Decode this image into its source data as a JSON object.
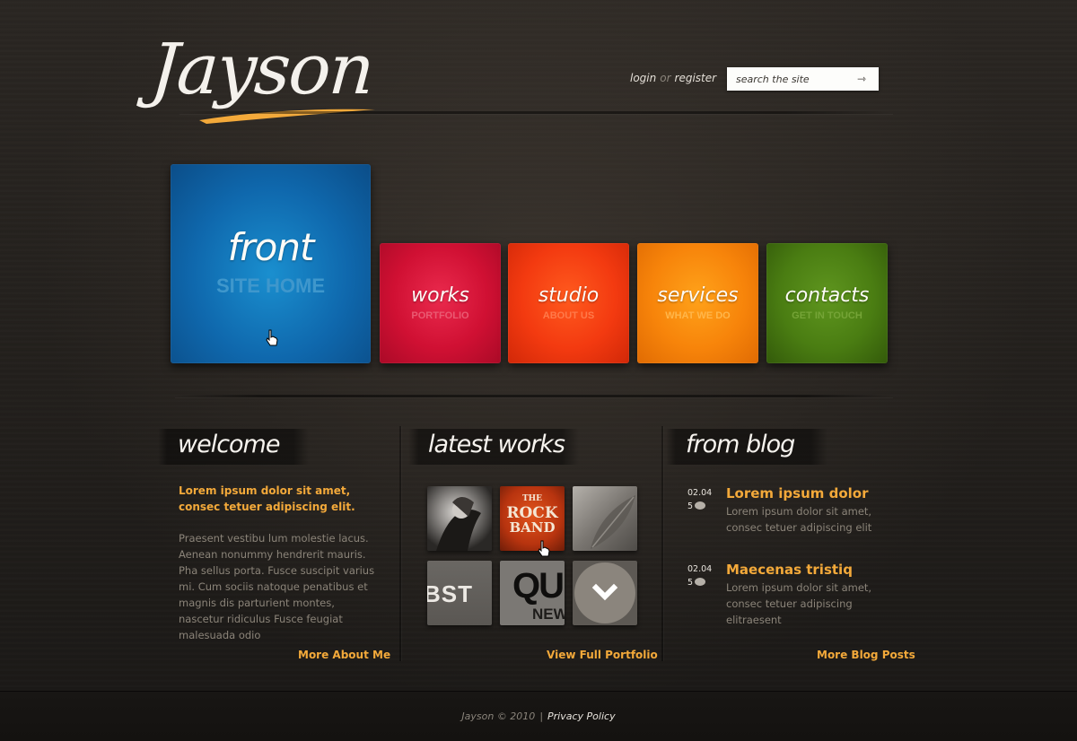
{
  "brand": {
    "logo_text": "Jayson",
    "accent": "#f3a93a"
  },
  "header": {
    "login_label": "login",
    "or_label": "or",
    "register_label": "register",
    "search": {
      "placeholder": "search the site",
      "go_icon": "arrow-right-icon"
    }
  },
  "nav": {
    "front": {
      "title": "front",
      "subtitle": "SITE HOME",
      "color": "#0f68ad"
    },
    "works": {
      "title": "works",
      "subtitle": "PORTFOLIO",
      "color": "#d01033"
    },
    "studio": {
      "title": "studio",
      "subtitle": "ABOUT US",
      "color": "#f33a10"
    },
    "services": {
      "title": "services",
      "subtitle": "WHAT WE DO",
      "color": "#f7840a"
    },
    "contacts": {
      "title": "contacts",
      "subtitle": "GET IN TOUCH",
      "color": "#4a7d12"
    }
  },
  "welcome": {
    "heading": "welcome",
    "lead": "Lorem ipsum dolor sit amet, consec tetuer adipiscing elit.",
    "body": "Praesent vestibu lum molestie lacus. Aenean nonummy hendrerit mauris. Pha sellus porta. Fusce suscipit varius mi. Cum sociis natoque penatibus et magnis dis parturient montes, nascetur ridiculus Fusce feugiat malesuada odio",
    "more_label": "More About Me"
  },
  "works": {
    "heading": "latest works",
    "thumbs": [
      {
        "name": "singer-photo"
      },
      {
        "name": "rock-band",
        "text_line1": "THE",
        "text_line2": "ROCK",
        "text_line3": "BAND"
      },
      {
        "name": "leaf-photo"
      },
      {
        "name": "bst-logo",
        "text": "BST"
      },
      {
        "name": "qu-news",
        "text_big": "QU",
        "text_small": "NEW"
      },
      {
        "name": "more-down",
        "icon": "chevron-down-icon"
      }
    ],
    "more_label": "View Full Portfolio"
  },
  "blog": {
    "heading": "from blog",
    "posts": [
      {
        "date": "02.04",
        "comments": "5",
        "title": "Lorem ipsum dolor",
        "text": "Lorem ipsum dolor sit amet, consec tetuer adipiscing elit"
      },
      {
        "date": "02.04",
        "comments": "5",
        "title": "Maecenas tristiq",
        "text": "Lorem ipsum dolor sit amet, consec tetuer adipiscing elitraesent"
      }
    ],
    "more_label": "More Blog Posts"
  },
  "footer": {
    "copyright": "Jayson © 2010",
    "privacy_label": "Privacy Policy"
  }
}
